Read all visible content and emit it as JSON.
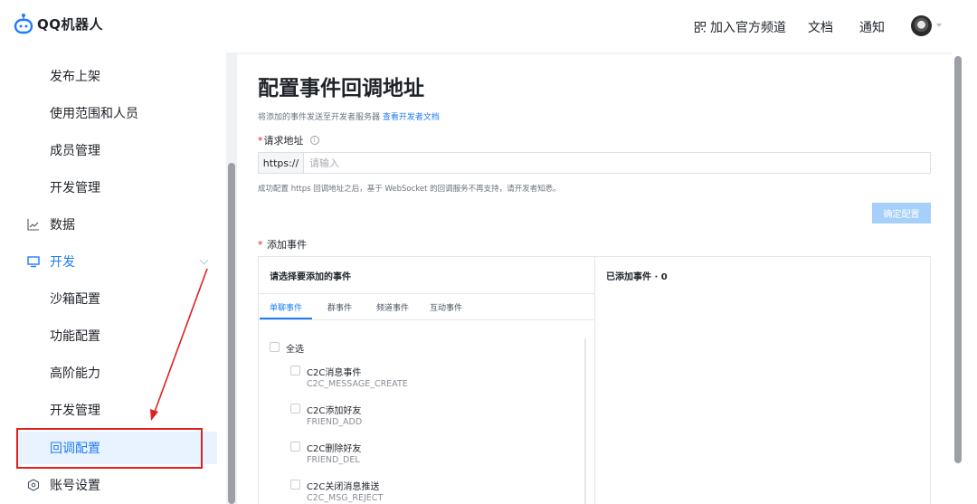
{
  "app": {
    "logo_text": "QQ机器人"
  },
  "topbar": {
    "channel_label": "加入官方频道",
    "docs_label": "文档",
    "notice_label": "通知"
  },
  "sidebar": {
    "items": [
      {
        "label": "发布上架"
      },
      {
        "label": "使用范围和人员"
      },
      {
        "label": "成员管理"
      },
      {
        "label": "开发管理"
      },
      {
        "label": "数据"
      },
      {
        "label": "开发"
      },
      {
        "label": "沙箱配置"
      },
      {
        "label": "功能配置"
      },
      {
        "label": "高阶能力"
      },
      {
        "label": "开发管理"
      },
      {
        "label": "回调配置"
      },
      {
        "label": "账号设置"
      }
    ]
  },
  "main": {
    "title": "配置事件回调地址",
    "desc_text": "将添加的事件发送至开发者服务器",
    "desc_link": "查看开发者文档",
    "request_label_star": "*",
    "request_label": "请求地址",
    "url_prefix": "https://",
    "url_placeholder": "请输入",
    "url_value": "",
    "url_note": "成功配置 https 回调地址之后，基于 WebSocket 的回调服务不再支持，请开发者知悉。",
    "confirm_label": "确定配置",
    "event_label_star": "*",
    "event_label": "添加事件",
    "left_panel_title": "请选择要添加的事件",
    "right_panel_title": "已添加事件 · 0",
    "tabs": [
      {
        "label": "单聊事件"
      },
      {
        "label": "群事件"
      },
      {
        "label": "频道事件"
      },
      {
        "label": "互动事件"
      }
    ],
    "select_all": "全选",
    "events": [
      {
        "name": "C2C消息事件",
        "code": "C2C_MESSAGE_CREATE"
      },
      {
        "name": "C2C添加好友",
        "code": "FRIEND_ADD"
      },
      {
        "name": "C2C删除好友",
        "code": "FRIEND_DEL"
      },
      {
        "name": "C2C关闭消息推送",
        "code": "C2C_MSG_REJECT"
      }
    ]
  },
  "colors": {
    "accent": "#1f7cf7",
    "annotation": "#e02020",
    "selected_bg": "#e8f3ff",
    "disabled_button": "#a6cffa"
  }
}
